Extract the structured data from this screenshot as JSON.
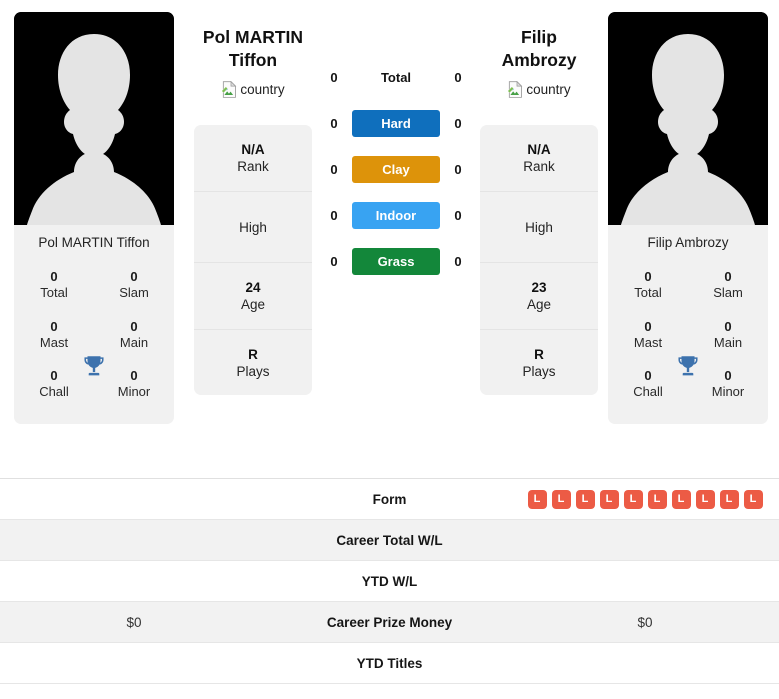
{
  "players": {
    "left": {
      "display_name": "Pol MARTIN Tiffon",
      "name_line1": "Pol MARTIN",
      "name_line2": "Tiffon",
      "photo_name": "Pol MARTIN Tiffon",
      "country_alt": "country",
      "titles": [
        {
          "value": "0",
          "label": "Total"
        },
        {
          "value": "0",
          "label": "Slam"
        },
        {
          "value": "0",
          "label": "Mast"
        },
        {
          "value": "0",
          "label": "Main"
        },
        {
          "value": "0",
          "label": "Chall"
        },
        {
          "value": "0",
          "label": "Minor"
        }
      ],
      "bio": [
        {
          "value": "N/A",
          "label": "Rank"
        },
        {
          "value": "",
          "label": "High"
        },
        {
          "value": "24",
          "label": "Age"
        },
        {
          "value": "R",
          "label": "Plays"
        }
      ],
      "surface_wins": {
        "total": "0",
        "hard": "0",
        "clay": "0",
        "indoor": "0",
        "grass": "0"
      },
      "form": [
        "L",
        "L",
        "L",
        "L",
        "L",
        "L",
        "L",
        "L",
        "L",
        "L"
      ],
      "career_total_wl": "",
      "ytd_wl": "",
      "career_prize_money": "$0",
      "ytd_titles": ""
    },
    "right": {
      "display_name": "Filip Ambrozy",
      "name_line1": "Filip",
      "name_line2": "Ambrozy",
      "photo_name": "Filip Ambrozy",
      "country_alt": "country",
      "titles": [
        {
          "value": "0",
          "label": "Total"
        },
        {
          "value": "0",
          "label": "Slam"
        },
        {
          "value": "0",
          "label": "Mast"
        },
        {
          "value": "0",
          "label": "Main"
        },
        {
          "value": "0",
          "label": "Chall"
        },
        {
          "value": "0",
          "label": "Minor"
        }
      ],
      "bio": [
        {
          "value": "N/A",
          "label": "Rank"
        },
        {
          "value": "",
          "label": "High"
        },
        {
          "value": "23",
          "label": "Age"
        },
        {
          "value": "R",
          "label": "Plays"
        }
      ],
      "surface_wins": {
        "total": "0",
        "hard": "0",
        "clay": "0",
        "indoor": "0",
        "grass": "0"
      },
      "career_total_wl": "",
      "ytd_wl": "",
      "career_prize_money": "$0",
      "ytd_titles": ""
    }
  },
  "surfaces": [
    {
      "key": "total",
      "label": "Total",
      "color": "transparent"
    },
    {
      "key": "hard",
      "label": "Hard",
      "color": "#0f6fbd"
    },
    {
      "key": "clay",
      "label": "Clay",
      "color": "#dd930a"
    },
    {
      "key": "indoor",
      "label": "Indoor",
      "color": "#38a3f2"
    },
    {
      "key": "grass",
      "label": "Grass",
      "color": "#13873a"
    }
  ],
  "table_rows": [
    {
      "key": "form",
      "label": "Form"
    },
    {
      "key": "career_total_wl",
      "label": "Career Total W/L"
    },
    {
      "key": "ytd_wl",
      "label": "YTD W/L"
    },
    {
      "key": "career_prize_money",
      "label": "Career Prize Money"
    },
    {
      "key": "ytd_titles",
      "label": "YTD Titles"
    }
  ],
  "colors": {
    "form_loss": "#ec5b45",
    "trophy": "#3d72ad",
    "card_bg": "#f1f1f1",
    "row_alt": "#f2f2f2"
  },
  "icons": {
    "trophy": "trophy-icon",
    "broken_image": "broken-image-icon",
    "avatar": "avatar-silhouette-icon"
  }
}
